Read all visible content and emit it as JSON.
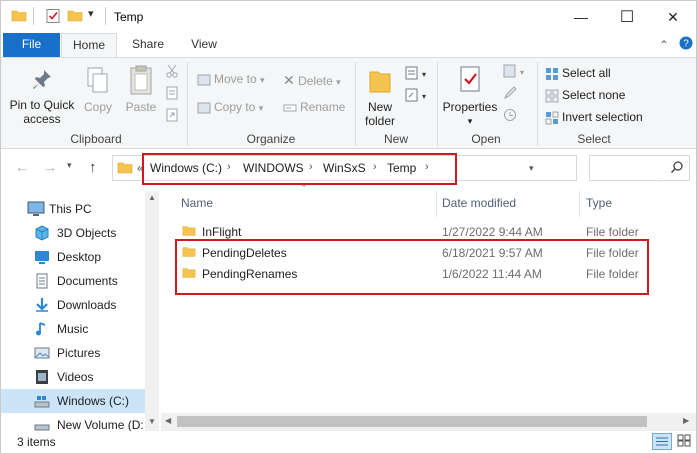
{
  "window": {
    "title": "Temp",
    "controls": [
      "—",
      "☐",
      "✕"
    ]
  },
  "ribbon_tabs": {
    "file": "File",
    "home": "Home",
    "share": "Share",
    "view": "View"
  },
  "ribbon": {
    "clipboard": {
      "pin_label": "Pin to Quick access",
      "pin_line1": "Pin to Quick",
      "pin_line2": "access",
      "copy": "Copy",
      "paste": "Paste",
      "group": "Clipboard"
    },
    "organize": {
      "move_to": "Move to",
      "copy_to": "Copy to",
      "delete": "Delete",
      "rename": "Rename",
      "group": "Organize"
    },
    "new": {
      "new_folder_line1": "New",
      "new_folder_line2": "folder",
      "group": "New"
    },
    "open": {
      "properties": "Properties",
      "group": "Open"
    },
    "select": {
      "select_all": "Select all",
      "select_none": "Select none",
      "invert_selection": "Invert selection",
      "group": "Select"
    }
  },
  "address": {
    "overflow": "«",
    "segments": [
      "Windows (C:)",
      "WINDOWS",
      "WinSxS",
      "Temp"
    ],
    "separator": "›"
  },
  "navigation_pane": [
    {
      "label": "This PC",
      "icon": "computer-icon",
      "indent": false,
      "selected": false
    },
    {
      "label": "3D Objects",
      "icon": "3d-objects-icon",
      "indent": true,
      "selected": false
    },
    {
      "label": "Desktop",
      "icon": "desktop-icon",
      "indent": true,
      "selected": false
    },
    {
      "label": "Documents",
      "icon": "documents-icon",
      "indent": true,
      "selected": false
    },
    {
      "label": "Downloads",
      "icon": "downloads-icon",
      "indent": true,
      "selected": false
    },
    {
      "label": "Music",
      "icon": "music-icon",
      "indent": true,
      "selected": false
    },
    {
      "label": "Pictures",
      "icon": "pictures-icon",
      "indent": true,
      "selected": false
    },
    {
      "label": "Videos",
      "icon": "videos-icon",
      "indent": true,
      "selected": false
    },
    {
      "label": "Windows (C:)",
      "icon": "drive-icon",
      "indent": true,
      "selected": true
    },
    {
      "label": "New Volume (D:",
      "icon": "drive-icon",
      "indent": true,
      "selected": false
    }
  ],
  "columns": {
    "name": "Name",
    "date_modified": "Date modified",
    "type": "Type"
  },
  "files": [
    {
      "name": "InFlight",
      "date": "1/27/2022 9:44 AM",
      "type": "File folder"
    },
    {
      "name": "PendingDeletes",
      "date": "6/18/2021 9:57 AM",
      "type": "File folder"
    },
    {
      "name": "PendingRenames",
      "date": "1/6/2022 11:44 AM",
      "type": "File folder"
    }
  ],
  "status": {
    "item_count": "3 items"
  },
  "colors": {
    "accent": "#1a6fc9",
    "highlight_box": "#d0181f",
    "folder": "#f4c44e",
    "selected_bg": "#cce4f7"
  }
}
